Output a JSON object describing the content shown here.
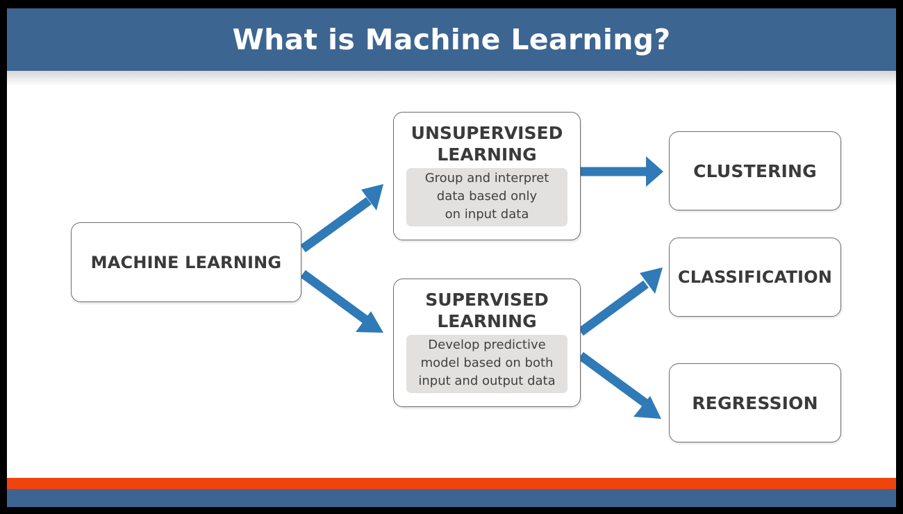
{
  "title": "What is Machine Learning?",
  "colors": {
    "header": "#3d6591",
    "accent_stripe": "#f0440f",
    "arrow": "#2f7ab7",
    "box_border": "#6c6c6c",
    "description_fill": "#e2e1df",
    "label_text": "#3a3a3a"
  },
  "nodes": {
    "machine_learning": {
      "label": "MACHINE LEARNING"
    },
    "unsupervised": {
      "title_lines": [
        "UNSUPERVISED",
        "LEARNING"
      ],
      "description_lines": [
        "Group and interpret",
        "data based only",
        "on input data"
      ]
    },
    "supervised": {
      "title_lines": [
        "SUPERVISED",
        "LEARNING"
      ],
      "description_lines": [
        "Develop predictive",
        "model based on both",
        "input and output data"
      ]
    },
    "clustering": {
      "label": "CLUSTERING"
    },
    "classification": {
      "label": "CLASSIFICATION"
    },
    "regression": {
      "label": "REGRESSION"
    }
  },
  "edges": [
    {
      "from": "MACHINE LEARNING",
      "to": "UNSUPERVISED LEARNING"
    },
    {
      "from": "MACHINE LEARNING",
      "to": "SUPERVISED LEARNING"
    },
    {
      "from": "UNSUPERVISED LEARNING",
      "to": "CLUSTERING"
    },
    {
      "from": "SUPERVISED LEARNING",
      "to": "CLASSIFICATION"
    },
    {
      "from": "SUPERVISED LEARNING",
      "to": "REGRESSION"
    }
  ]
}
